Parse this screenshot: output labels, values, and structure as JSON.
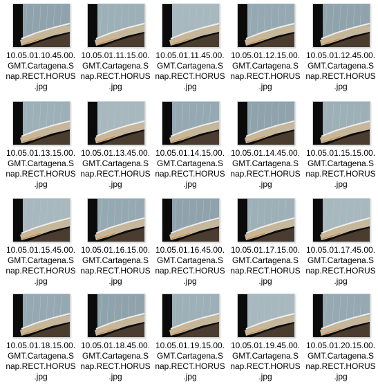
{
  "colors": {
    "background": "#ffffff",
    "label_text": "#000000",
    "thumb_border": "#d4d4d4"
  },
  "icon": "jpg-image-thumbnail-icon",
  "files": [
    {
      "line1": "10.05.01.10.45.00.",
      "line2": "GMT.Cartagena.S",
      "line3": "nap.RECT.HORUS",
      "line4": ".jpg"
    },
    {
      "line1": "10.05.01.11.15.00.",
      "line2": "GMT.Cartagena.S",
      "line3": "nap.RECT.HORUS",
      "line4": ".jpg"
    },
    {
      "line1": "10.05.01.11.45.00.",
      "line2": "GMT.Cartagena.S",
      "line3": "nap.RECT.HORUS",
      "line4": ".jpg"
    },
    {
      "line1": "10.05.01.12.15.00.",
      "line2": "GMT.Cartagena.S",
      "line3": "nap.RECT.HORUS",
      "line4": ".jpg"
    },
    {
      "line1": "10.05.01.12.45.00.",
      "line2": "GMT.Cartagena.S",
      "line3": "nap.RECT.HORUS",
      "line4": ".jpg"
    },
    {
      "line1": "10.05.01.13.15.00.",
      "line2": "GMT.Cartagena.S",
      "line3": "nap.RECT.HORUS",
      "line4": ".jpg"
    },
    {
      "line1": "10.05.01.13.45.00.",
      "line2": "GMT.Cartagena.S",
      "line3": "nap.RECT.HORUS",
      "line4": ".jpg"
    },
    {
      "line1": "10.05.01.14.15.00.",
      "line2": "GMT.Cartagena.S",
      "line3": "nap.RECT.HORUS",
      "line4": ".jpg"
    },
    {
      "line1": "10.05.01.14.45.00.",
      "line2": "GMT.Cartagena.S",
      "line3": "nap.RECT.HORUS",
      "line4": ".jpg"
    },
    {
      "line1": "10.05.01.15.15.00.",
      "line2": "GMT.Cartagena.S",
      "line3": "nap.RECT.HORUS",
      "line4": ".jpg"
    },
    {
      "line1": "10.05.01.15.45.00.",
      "line2": "GMT.Cartagena.S",
      "line3": "nap.RECT.HORUS",
      "line4": ".jpg"
    },
    {
      "line1": "10.05.01.16.15.00.",
      "line2": "GMT.Cartagena.S",
      "line3": "nap.RECT.HORUS",
      "line4": ".jpg"
    },
    {
      "line1": "10.05.01.16.45.00.",
      "line2": "GMT.Cartagena.S",
      "line3": "nap.RECT.HORUS",
      "line4": ".jpg"
    },
    {
      "line1": "10.05.01.17.15.00.",
      "line2": "GMT.Cartagena.S",
      "line3": "nap.RECT.HORUS",
      "line4": ".jpg"
    },
    {
      "line1": "10.05.01.17.45.00.",
      "line2": "GMT.Cartagena.S",
      "line3": "nap.RECT.HORUS",
      "line4": ".jpg"
    },
    {
      "line1": "10.05.01.18.15.00.",
      "line2": "GMT.Cartagena.S",
      "line3": "nap.RECT.HORUS",
      "line4": ".jpg"
    },
    {
      "line1": "10.05.01.18.45.00.",
      "line2": "GMT.Cartagena.S",
      "line3": "nap.RECT.HORUS",
      "line4": ".jpg"
    },
    {
      "line1": "10.05.01.19.15.00.",
      "line2": "GMT.Cartagena.S",
      "line3": "nap.RECT.HORUS",
      "line4": ".jpg"
    },
    {
      "line1": "10.05.01.19.45.00.",
      "line2": "GMT.Cartagena.S",
      "line3": "nap.RECT.HORUS",
      "line4": ".jpg"
    },
    {
      "line1": "10.05.01.20.15.00.",
      "line2": "GMT.Cartagena.S",
      "line3": "nap.RECT.HORUS",
      "line4": ".jpg"
    }
  ]
}
